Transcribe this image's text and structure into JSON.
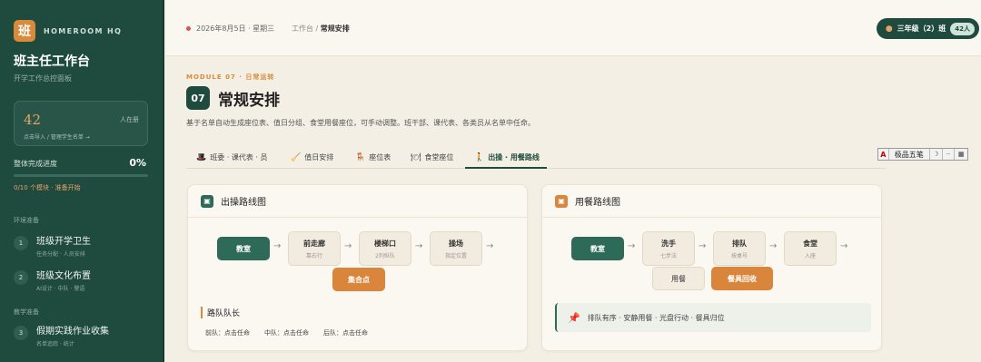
{
  "sidebar": {
    "logo_char": "班",
    "brand_name": "HOMEROOM HQ",
    "title": "班主任工作台",
    "subtitle": "开学工作总控面板",
    "stat": {
      "number": "42",
      "right": "人在册",
      "link": "点击导入 / 管理学生名单 →"
    },
    "progress": {
      "label": "整体完成进度",
      "percent": "0%",
      "fraction": 0,
      "note": "0/10 个模块 · 准备开始"
    },
    "sections": [
      {
        "label": "环境准备"
      },
      {
        "label": "教学准备"
      }
    ],
    "items": [
      {
        "num": "1",
        "title": "班级开学卫生",
        "sub": "任务分配 · 人员安排"
      },
      {
        "num": "2",
        "title": "班级文化布置",
        "sub": "AI设计 · 中队 · 警语"
      },
      {
        "num": "3",
        "title": "假期实践作业收集",
        "sub": "名单追踪 · 统计"
      }
    ]
  },
  "topbar": {
    "date": "2026年8月5日 · 星期三",
    "crumb_prefix": "工作台 / ",
    "crumb_current": "常规安排",
    "class_name": "三年级（2）班",
    "class_count": "42人"
  },
  "module": {
    "tag": "MODULE 07 · 日常运转",
    "num": "07",
    "title": "常规安排",
    "desc": "基于名单自动生成座位表、值日分组、食堂用餐座位，可手动调整。班干部、课代表、各类员从名单中任命。"
  },
  "tabs": [
    {
      "icon": "🎩",
      "label": "班委 · 课代表 · 员"
    },
    {
      "icon": "🧹",
      "label": "值日安排"
    },
    {
      "icon": "🪑",
      "label": "座位表"
    },
    {
      "icon": "🍽",
      "label": "食堂座位"
    },
    {
      "icon": "🚶",
      "label": "出操 · 用餐路线"
    }
  ],
  "ime": {
    "a": "A",
    "name": "极品五笔",
    "moon": "☽",
    "dots": "··",
    "kb": "▦"
  },
  "exercise_card": {
    "icon": "▣",
    "title": "出操路线图",
    "nodes": [
      {
        "main": "教室",
        "sub": ""
      },
      {
        "main": "前走廊",
        "sub": "靠右行"
      },
      {
        "main": "楼梯口",
        "sub": "2列纵队"
      },
      {
        "main": "操场",
        "sub": "指定位置"
      },
      {
        "main": "集合点",
        "sub": ""
      }
    ],
    "arrow": "→",
    "leader_title": "路队队长",
    "leaders": [
      "前队：点击任命",
      "中队：点击任命",
      "后队：点击任命"
    ]
  },
  "meal_card": {
    "icon": "▣",
    "title": "用餐路线图",
    "nodes": [
      {
        "main": "教室",
        "sub": ""
      },
      {
        "main": "洗手",
        "sub": "七步法"
      },
      {
        "main": "排队",
        "sub": "按桌号"
      },
      {
        "main": "食堂",
        "sub": "入座"
      },
      {
        "main": "用餐",
        "sub": ""
      },
      {
        "main": "餐具回收",
        "sub": ""
      }
    ],
    "arrow": "→",
    "tip_icon": "📌",
    "tip": "排队有序 · 安静用餐 · 光盘行动 · 餐具归位"
  },
  "colors": {
    "primary": "#1f4a3e",
    "accent": "#d98a3a",
    "background": "#f4efe5"
  }
}
